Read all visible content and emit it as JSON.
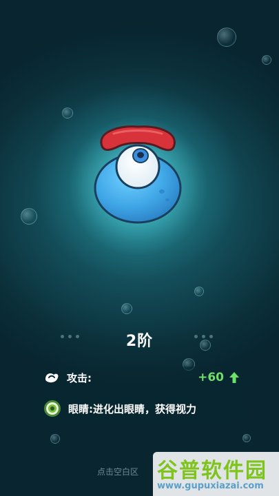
{
  "creature": {
    "level_text": "2阶"
  },
  "stats": [
    {
      "icon": "attack-icon",
      "label": "攻击:",
      "value": "+60",
      "trend": "up",
      "value_color": "#6ee06a"
    },
    {
      "icon": "eye-icon",
      "label": "眼睛:进化出眼睛，获得视力"
    }
  ],
  "hint": "点击空白区",
  "watermark": {
    "logo_text": "谷普软件园",
    "url": "www.gupuxiazai.com"
  },
  "colors": {
    "background": "#134c58",
    "glow": "#5aebf0",
    "body": "#3fa6e6",
    "hat": "#d8333b",
    "stat_positive": "#6ee06a"
  }
}
